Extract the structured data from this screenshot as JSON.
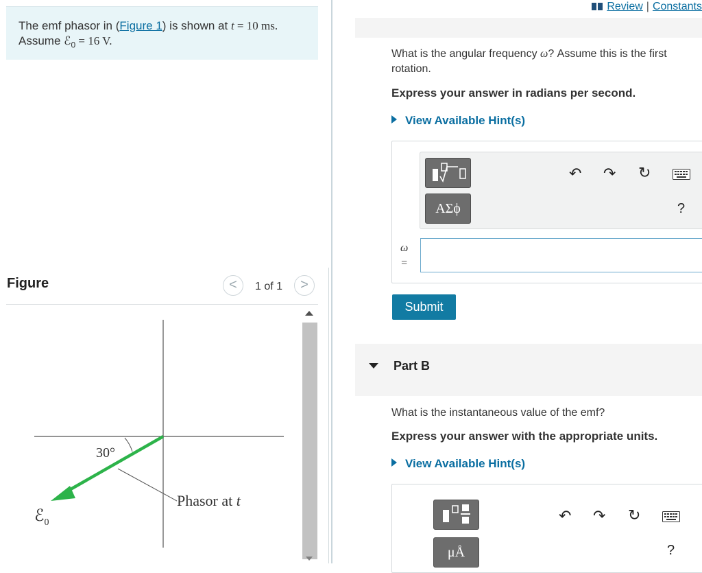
{
  "problem": {
    "text_before_link": "The emf phasor in (",
    "figure_link": "Figure 1",
    "text_after_link": ") is shown at ",
    "time_var": "t",
    "time_value": " = 10 ms.",
    "assume_prefix": "Assume ",
    "emf_symbol": "ℰ",
    "emf_sub": "0",
    "emf_value": " = 16 V."
  },
  "figure_panel": {
    "heading": "Figure",
    "prev_symbol": "<",
    "next_symbol": ">",
    "page_counter": "1 of 1",
    "angle_label": "30°",
    "phasor_label_text": "Phasor at ",
    "phasor_label_var": "t",
    "emf_label_symbol": "ℰ",
    "emf_label_sub": "0",
    "phasor_color": "#2db34a"
  },
  "header": {
    "review_link": "Review",
    "separator": "|",
    "constants_link": "Constants"
  },
  "partA": {
    "question_pre": "What is the angular frequency ",
    "question_var": "ω",
    "question_post": "? Assume this is the first rotation.",
    "instruction": "Express your answer in radians per second.",
    "hint_link": "View Available Hint(s)",
    "toolbar": {
      "templates_icon": "fraction-sqrt-template-icon",
      "symbols_button": "ΑΣϕ",
      "help_button": "?"
    },
    "answer_label_var": "ω",
    "answer_label_eq": "=",
    "answer_value": "",
    "submit_label": "Submit"
  },
  "partB": {
    "label": "Part B",
    "question": "What is the instantaneous value of the emf?",
    "instruction": "Express your answer with the appropriate units.",
    "hint_link": "View Available Hint(s)",
    "toolbar": {
      "templates_icon": "unit-template-icon",
      "units_button": "μÅ",
      "help_button": "?"
    }
  }
}
